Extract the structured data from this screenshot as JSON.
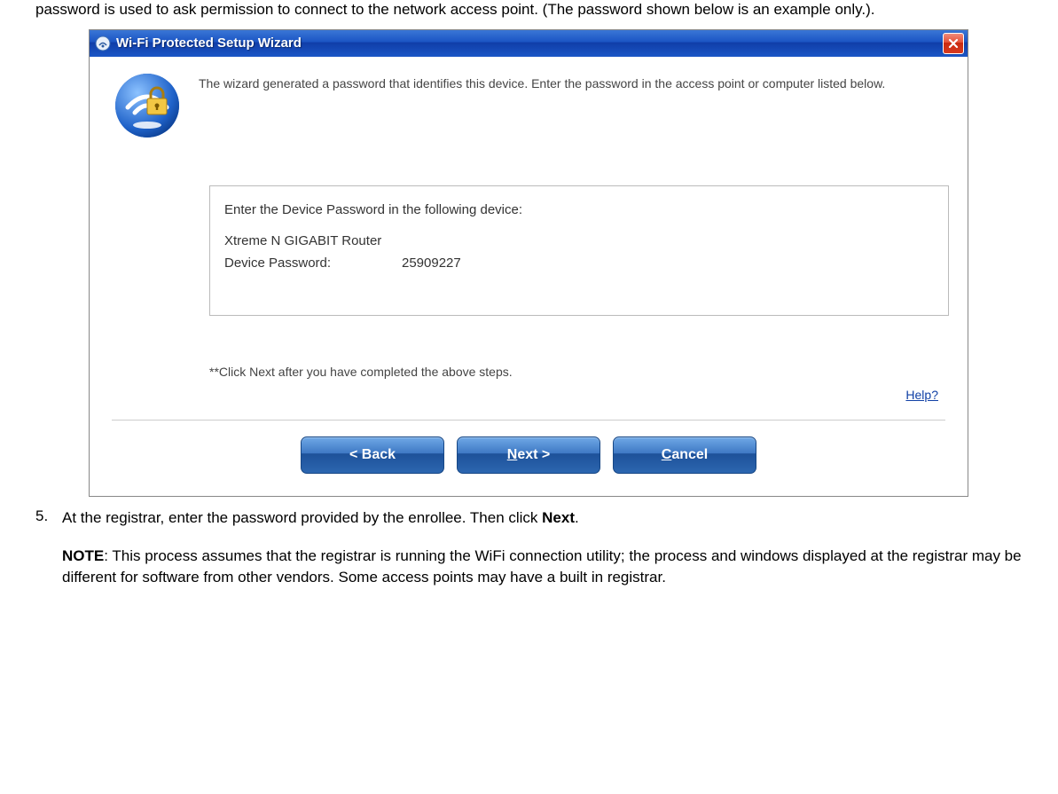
{
  "intro_text": "password is used to ask permission to connect to the network access point. (The password shown below is an example only.).",
  "wizard": {
    "title": "Wi-Fi Protected Setup Wizard",
    "instruction": "The wizard generated a password that identifies this device. Enter the password in the access point or computer listed below.",
    "device_prompt": "Enter the Device Password in the following device:",
    "device_name": "Xtreme N GIGABIT Router",
    "password_label": "Device Password:",
    "password_value": "25909227",
    "footnote": "**Click Next after you have completed the above steps.",
    "help_label": "Help?",
    "buttons": {
      "back": "< Back",
      "next": "Next >",
      "cancel": "Cancel"
    }
  },
  "step5": {
    "number": "5.",
    "text_prefix": "At the registrar, enter the password provided by the enrollee. Then click ",
    "text_bold": "Next",
    "text_suffix": "."
  },
  "note": {
    "label": "NOTE",
    "text": ": This process assumes that the registrar is running the WiFi connection utility; the process and windows displayed at the registrar may be different for software from other vendors. Some access points may have a built in registrar."
  }
}
